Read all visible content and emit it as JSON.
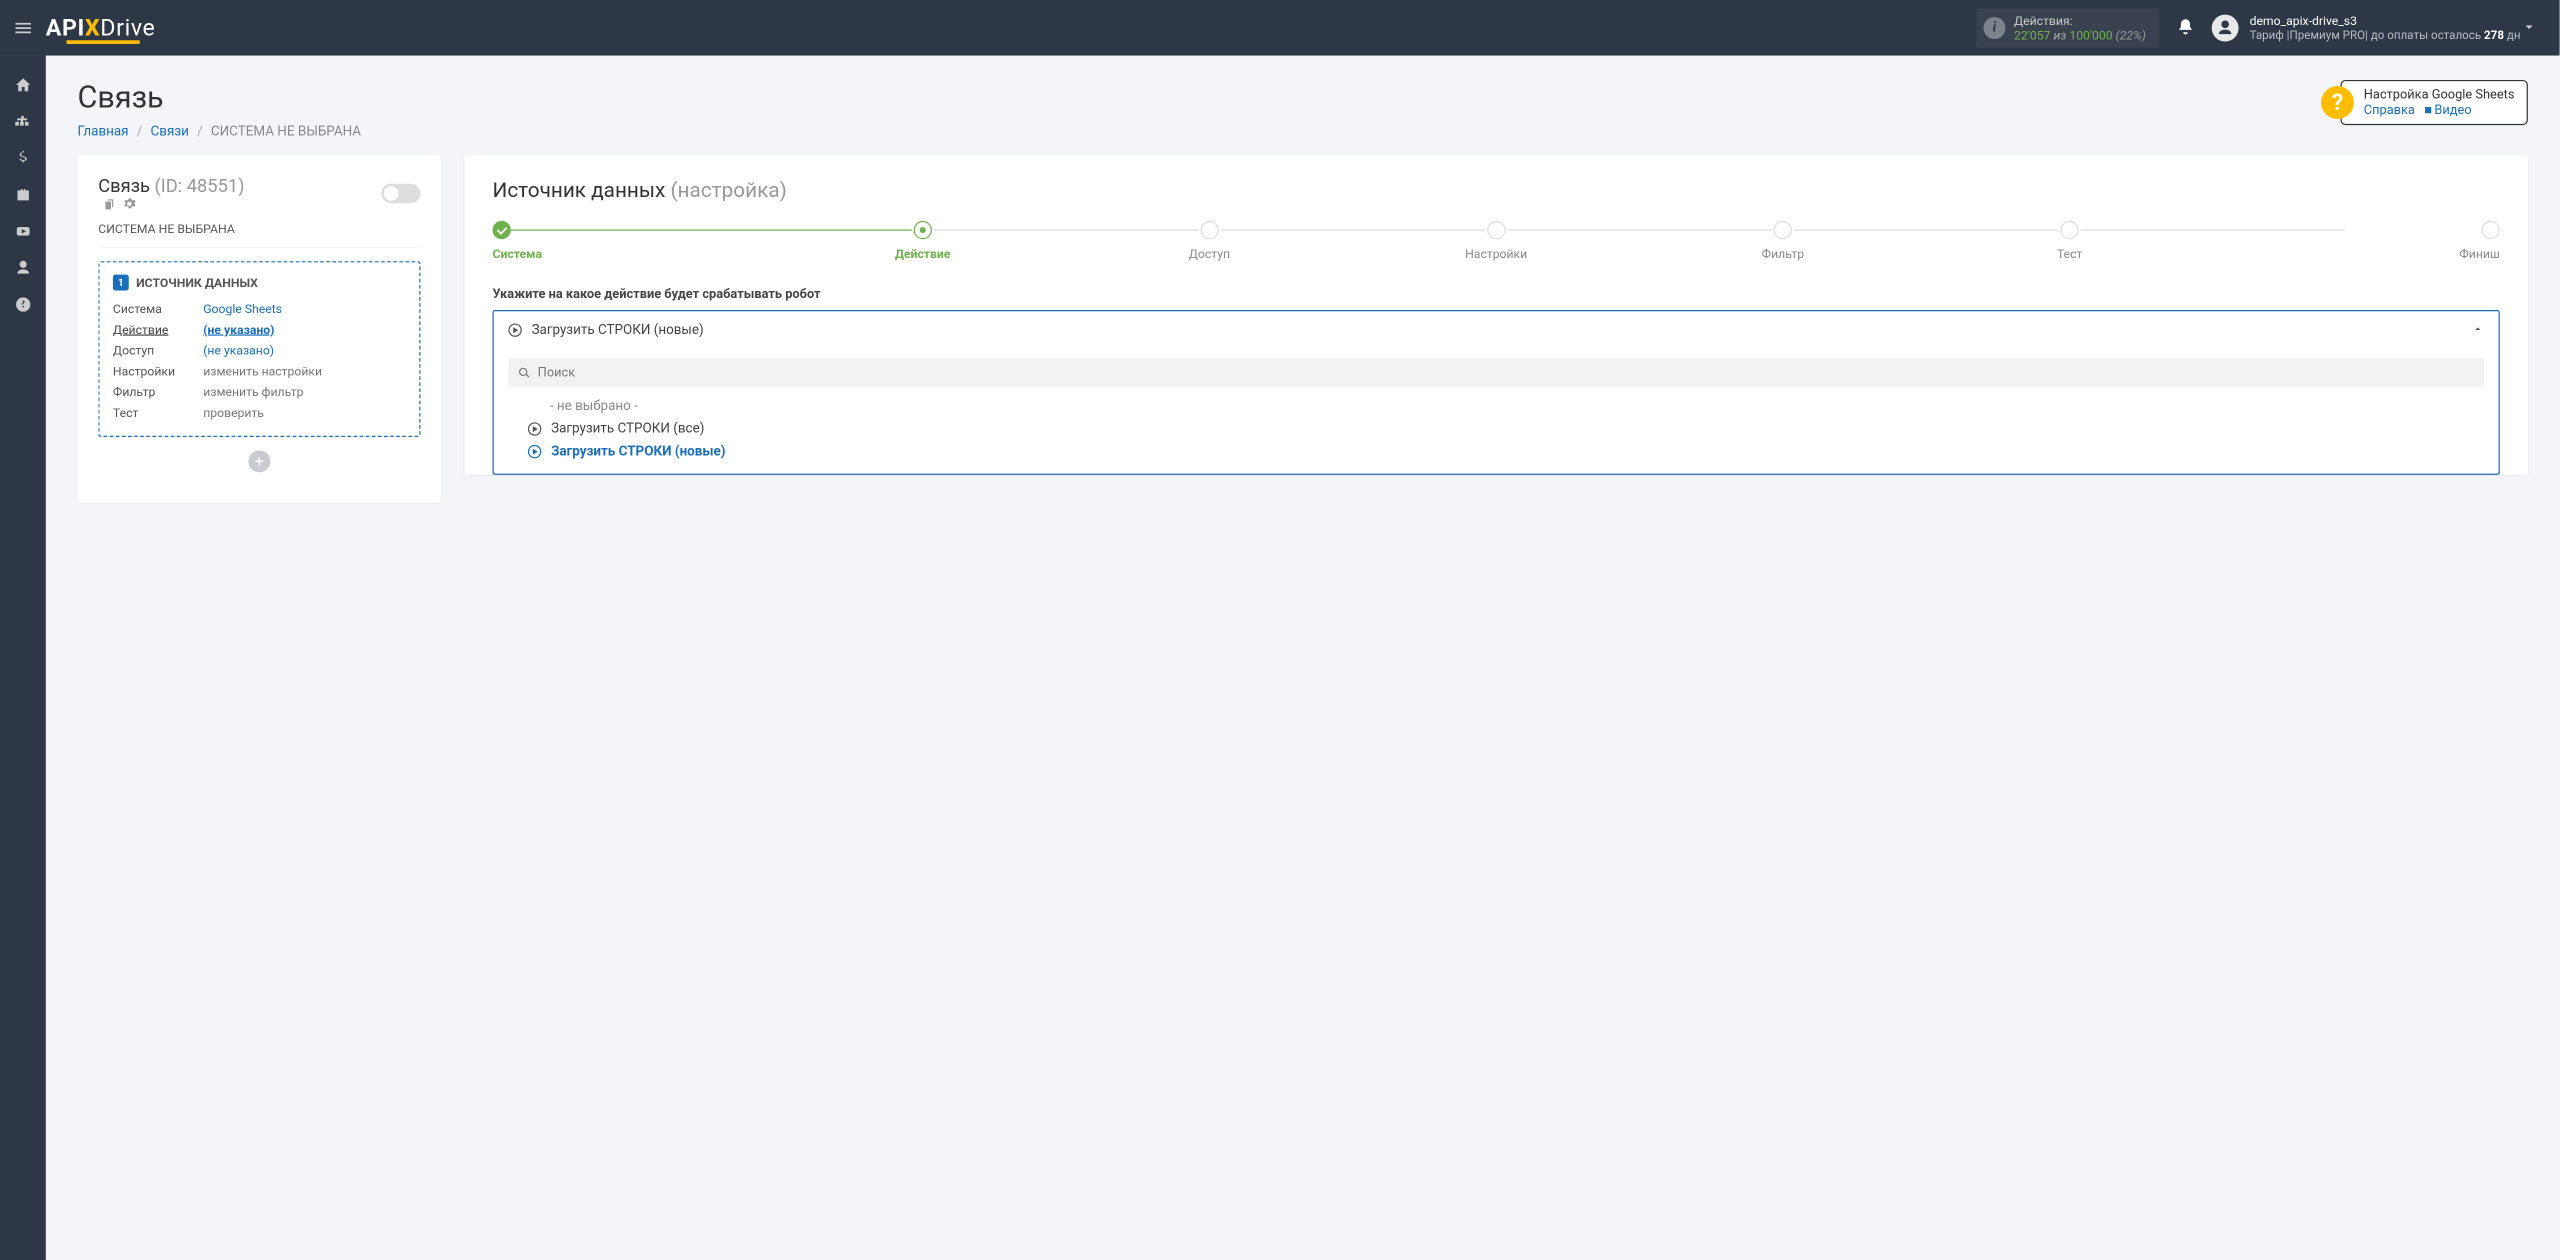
{
  "header": {
    "actions_label": "Действия:",
    "actions_count": "22'057",
    "actions_of": "из",
    "actions_total": "100'000",
    "actions_pct": "(22%)",
    "user_name": "demo_apix-drive_s3",
    "tariff_prefix": "Тариф |Премиум PRO| до оплаты осталось ",
    "tariff_days": "278",
    "tariff_suffix": " дн"
  },
  "page": {
    "title": "Связь",
    "breadcrumb": {
      "home": "Главная",
      "con": "Связи",
      "current": "СИСТЕМА НЕ ВЫБРАНА"
    }
  },
  "help": {
    "title": "Настройка Google Sheets",
    "link1": "Справка",
    "link2": "Видео"
  },
  "left_card": {
    "title_main": "Связь ",
    "title_id": "(ID: 48551)",
    "subtitle": "СИСТЕМА НЕ ВЫБРАНА",
    "source_header": "ИСТОЧНИК ДАННЫХ",
    "rows": {
      "system": {
        "label": "Система",
        "value": "Google Sheets"
      },
      "action": {
        "label": "Действие",
        "value": "(не указано)"
      },
      "access": {
        "label": "Доступ",
        "value": "(не указано)"
      },
      "settings": {
        "label": "Настройки",
        "value": "изменить настройки"
      },
      "filter": {
        "label": "Фильтр",
        "value": "изменить фильтр"
      },
      "test": {
        "label": "Тест",
        "value": "проверить"
      }
    }
  },
  "right_card": {
    "title_main": "Источник данных ",
    "title_sub": "(настройка)",
    "steps": [
      "Система",
      "Действие",
      "Доступ",
      "Настройки",
      "Фильтр",
      "Тест",
      "Финиш"
    ],
    "dropdown_label": "Укажите на какое действие будет срабатывать робот",
    "selected": "Загрузить СТРОКИ (новые)",
    "search_placeholder": "Поиск",
    "options": {
      "none": "- не выбрано -",
      "all": "Загрузить СТРОКИ (все)",
      "new": "Загрузить СТРОКИ (новые)"
    }
  }
}
